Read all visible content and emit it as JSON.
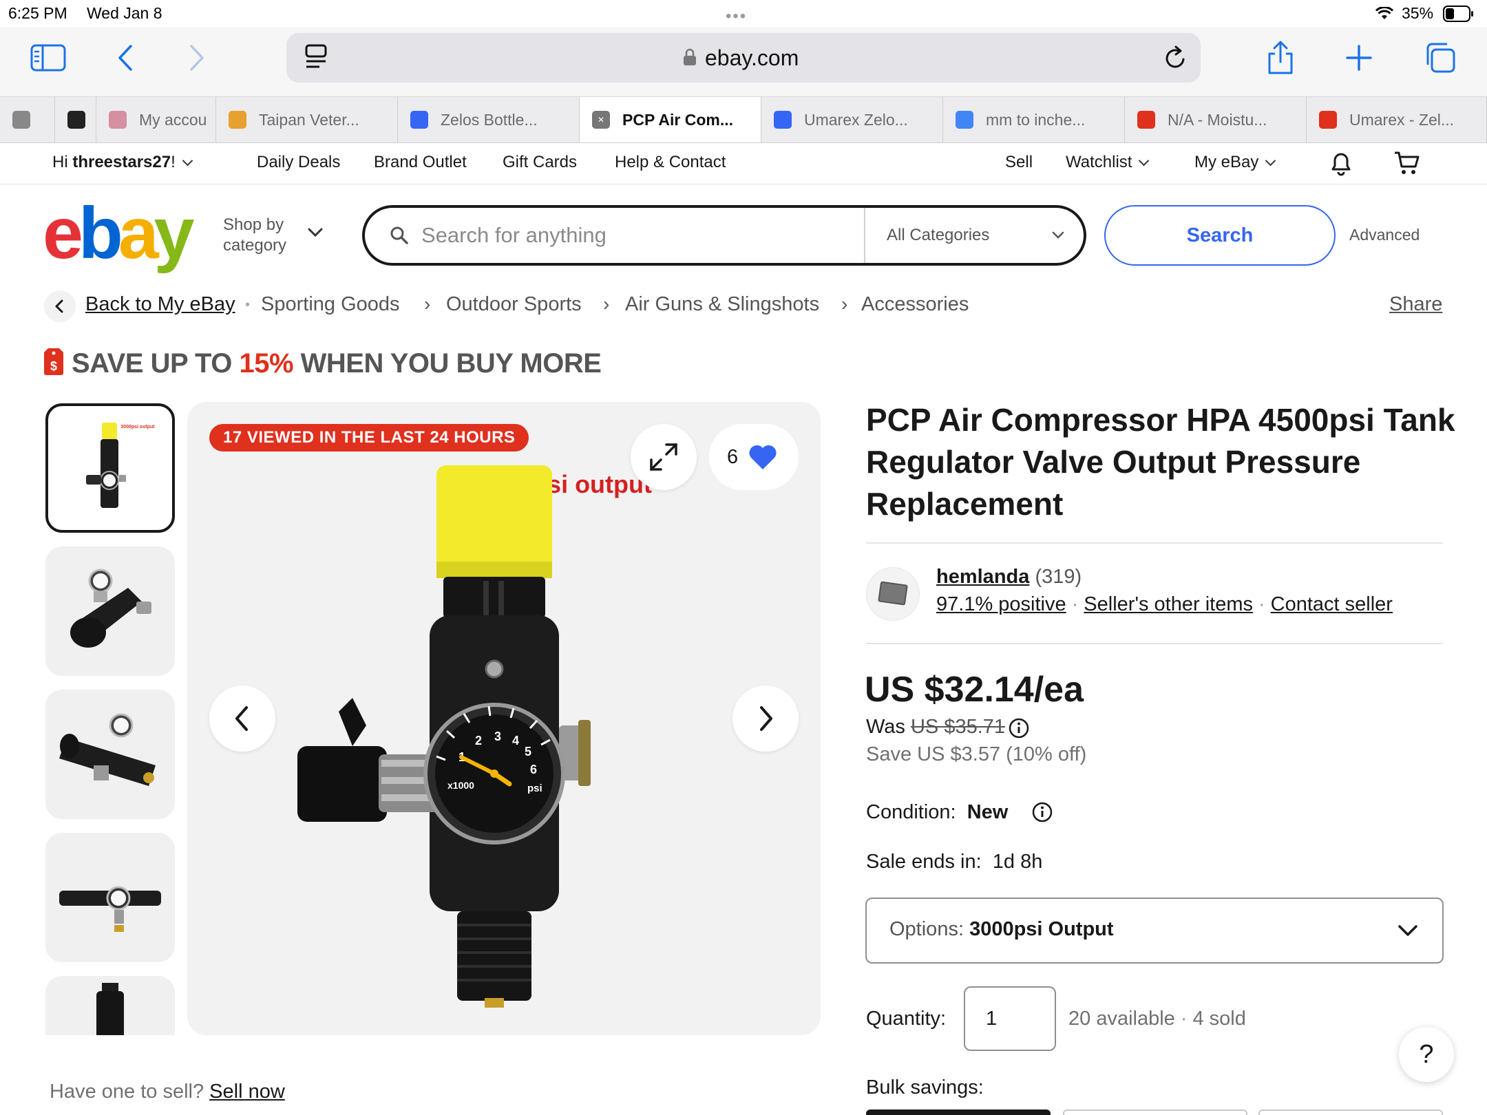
{
  "status_bar": {
    "time": "6:25 PM",
    "date": "Wed Jan 8",
    "battery": "35%"
  },
  "browser": {
    "url": "ebay.com",
    "tabs": [
      {
        "label": "",
        "favicon": "#888888"
      },
      {
        "label": "",
        "favicon": "#222222"
      },
      {
        "label": "My accou",
        "favicon": "#d48fa0"
      },
      {
        "label": "Taipan Veter...",
        "favicon": "#e8a030"
      },
      {
        "label": "Zelos Bottle...",
        "favicon": "#3665f3"
      },
      {
        "label": "PCP Air Com...",
        "favicon": "#777777",
        "active": true
      },
      {
        "label": "Umarex Zelo...",
        "favicon": "#3665f3"
      },
      {
        "label": "mm to inche...",
        "favicon": "#4285f4"
      },
      {
        "label": "N/A - Moistu...",
        "favicon": "#e0301e"
      },
      {
        "label": "Umarex - Zel...",
        "favicon": "#e0301e"
      }
    ]
  },
  "global_header": {
    "greeting_prefix": "Hi ",
    "username": "threestars27",
    "greeting_suffix": "!",
    "links": [
      "Daily Deals",
      "Brand Outlet",
      "Gift Cards",
      "Help & Contact"
    ],
    "sell": "Sell",
    "watchlist": "Watchlist",
    "my_ebay": "My eBay"
  },
  "search": {
    "shop_by_line1": "Shop by",
    "shop_by_line2": "category",
    "placeholder": "Search for anything",
    "category": "All Categories",
    "button": "Search",
    "advanced": "Advanced"
  },
  "breadcrumb": {
    "back": "Back to My eBay",
    "items": [
      "Sporting Goods",
      "Outdoor Sports",
      "Air Guns & Slingshots",
      "Accessories"
    ],
    "share": "Share"
  },
  "promo": {
    "prefix": "SAVE UP TO ",
    "highlight": "15%",
    "suffix": " WHEN YOU BUY MORE"
  },
  "gallery": {
    "badge": "17 VIEWED IN THE LAST 24 HOURS",
    "watch_count": "6",
    "image_caption": "3000psi output",
    "gauge_unit": "psi",
    "gauge_scale": "x1000",
    "thumbnail_caption": "3000psi output"
  },
  "item": {
    "title": "PCP Air Compressor HPA 4500psi Tank Regulator Valve Output Pressure Replacement",
    "seller": {
      "name": "hemlanda",
      "score": "(319)",
      "positive": "97.1% positive",
      "other_items": "Seller's other items",
      "contact": "Contact seller"
    },
    "price": "US $32.14/ea",
    "was_label": "Was ",
    "was_price": "US $35.71",
    "save": "Save US $3.57 (10% off)",
    "condition_label": "Condition:",
    "condition_value": "New",
    "sale_ends_label": "Sale ends in:",
    "sale_ends_value": "1d 8h",
    "options_label": "Options:",
    "options_value": "3000psi Output",
    "quantity_label": "Quantity:",
    "quantity_value": "1",
    "available": "20 available",
    "sold": "4 sold",
    "bulk_label": "Bulk savings:"
  },
  "sell_prompt": {
    "text": "Have one to sell? ",
    "link": "Sell now"
  },
  "help": "?",
  "colors": {
    "ebay_red": "#e53238",
    "ebay_blue": "#0064d2",
    "ebay_yellow": "#f5af02",
    "ebay_green": "#86b817",
    "accent": "#3665f3",
    "badge_red": "#e0301e"
  }
}
